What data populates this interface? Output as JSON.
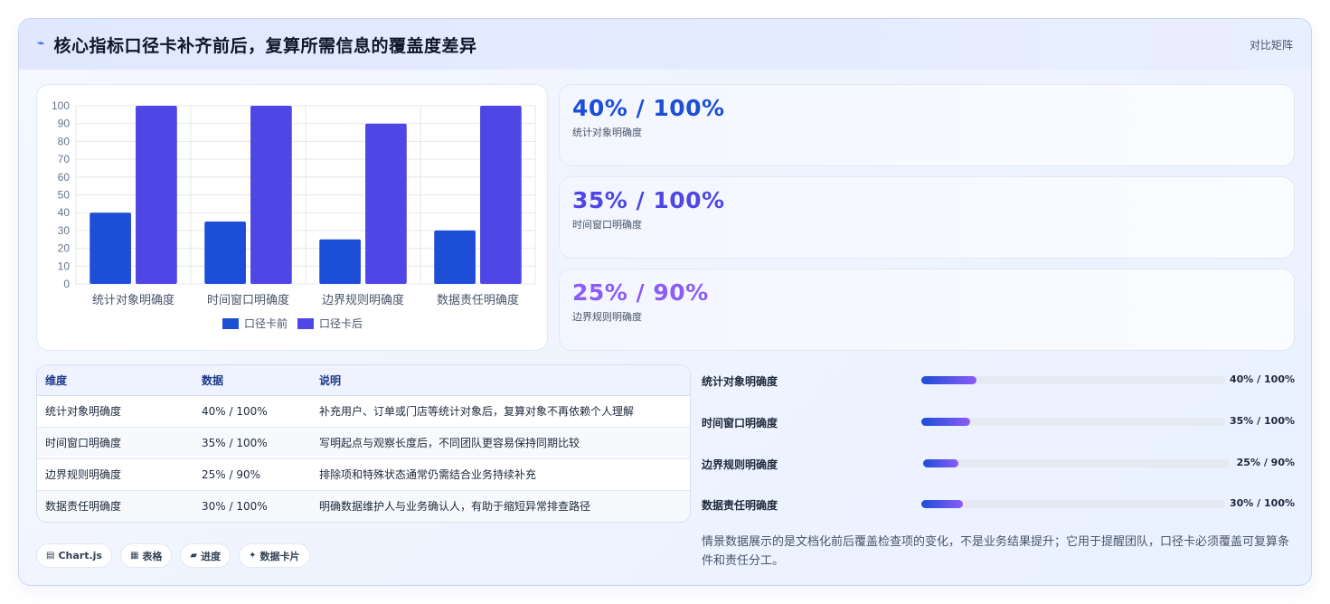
{
  "header": {
    "icon": "trend-line-icon",
    "title": "核心指标口径卡补齐前后，复算所需信息的覆盖度差异",
    "tag": "对比矩阵"
  },
  "colors": {
    "before": "#1d4ed8",
    "after": "#4f46e5",
    "stat_1": "#1d4ed8",
    "stat_2": "#4f46e5",
    "stat_3": "#8b5cf6"
  },
  "chart_data": {
    "type": "bar",
    "categories": [
      "统计对象明确度",
      "时间窗口明确度",
      "边界规则明确度",
      "数据责任明确度"
    ],
    "series": [
      {
        "name": "口径卡前",
        "values": [
          40,
          35,
          25,
          30
        ]
      },
      {
        "name": "口径卡后",
        "values": [
          100,
          100,
          90,
          100
        ]
      }
    ],
    "ylim": [
      0,
      100
    ],
    "yticks": [
      0,
      10,
      20,
      30,
      40,
      50,
      60,
      70,
      80,
      90,
      100
    ],
    "grid": true,
    "legend": "bottom"
  },
  "stats": [
    {
      "value": "40% / 100%",
      "label": "统计对象明确度"
    },
    {
      "value": "35% / 100%",
      "label": "时间窗口明确度"
    },
    {
      "value": "25% / 90%",
      "label": "边界规则明确度"
    }
  ],
  "table": {
    "headers": [
      "维度",
      "数据",
      "说明"
    ],
    "rows": [
      [
        "统计对象明确度",
        "40% / 100%",
        "补充用户、订单或门店等统计对象后，复算对象不再依赖个人理解"
      ],
      [
        "时间窗口明确度",
        "35% / 100%",
        "写明起点与观察长度后，不同团队更容易保持同期比较"
      ],
      [
        "边界规则明确度",
        "25% / 90%",
        "排除项和特殊状态通常仍需结合业务持续补充"
      ],
      [
        "数据责任明确度",
        "30% / 100%",
        "明确数据维护人与业务确认人，有助于缩短异常排查路径"
      ]
    ]
  },
  "progress": [
    {
      "label": "统计对象明确度",
      "value": "40% / 100%",
      "before": 40,
      "after": 100
    },
    {
      "label": "时间窗口明确度",
      "value": "35% / 100%",
      "before": 35,
      "after": 100
    },
    {
      "label": "边界规则明确度",
      "value": "25% / 90%",
      "before": 25,
      "after": 90
    },
    {
      "label": "数据责任明确度",
      "value": "30% / 100%",
      "before": 30,
      "after": 100
    }
  ],
  "chips": [
    {
      "icon": "chart-icon",
      "glyph": "▤",
      "label": "Chart.js"
    },
    {
      "icon": "table-icon",
      "glyph": "▦",
      "label": "表格"
    },
    {
      "icon": "progress-icon",
      "glyph": "▰",
      "label": "进度"
    },
    {
      "icon": "sparkle-icon",
      "glyph": "✦",
      "label": "数据卡片"
    }
  ],
  "note": "情景数据展示的是文档化前后覆盖检查项的变化，不是业务结果提升；它用于提醒团队，口径卡必须覆盖可复算条件和责任分工。"
}
